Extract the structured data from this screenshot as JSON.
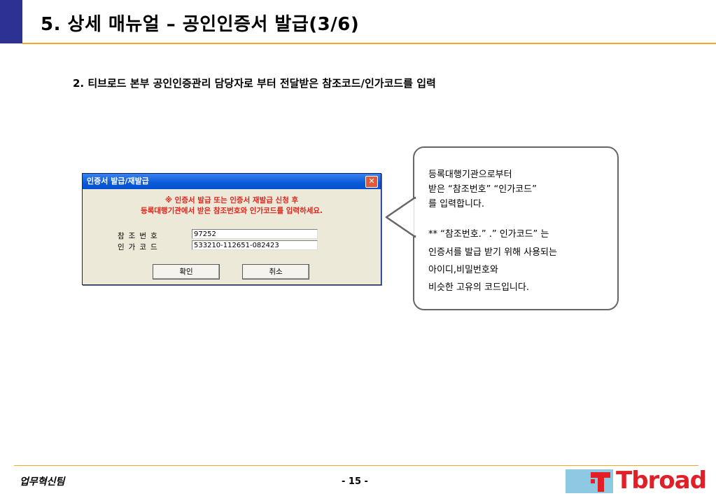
{
  "slide": {
    "title": "5. 상세 매뉴얼 – 공인인증서 발급(3/6)",
    "subtitle": "2. 티브로드 본부 공인인증관리 담당자로 부터 전달받은 참조코드/인가코드를 입력"
  },
  "dialog": {
    "title": "인증서 발급/재발급",
    "warning_line1": "※ 인증서 발급 또는 인증서 재발급 신청 후",
    "warning_line2": "등록대행기관에서 받은 참조번호와 인가코드를 입력하세요.",
    "ref_label": "참조번호",
    "ref_value": "97252",
    "auth_label": "인가코드",
    "auth_value": "533210-112651-082423",
    "ok_label": "확인",
    "cancel_label": "취소"
  },
  "callout": {
    "line1": "등록대행기관으로부터",
    "line2": "받은  “참조번호”   “인가코드”",
    "line3": "를 입력합니다.",
    "line4": "**  “참조번호.” .” 인가코드” 는",
    "line5": "인증서를 발급 받기 위해 사용되는",
    "line6": "아이디,비밀번호와",
    "line7": "비슷한 고유의 코드입니다."
  },
  "footer": {
    "team": "업무혁신팀",
    "page": "- 15 -",
    "logo_text": "Tbroad"
  },
  "colors": {
    "accent_navy": "#2c3192",
    "rule_orange": "#f5a623",
    "logo_red": "#e21f27",
    "warning_red": "#e0231b"
  }
}
